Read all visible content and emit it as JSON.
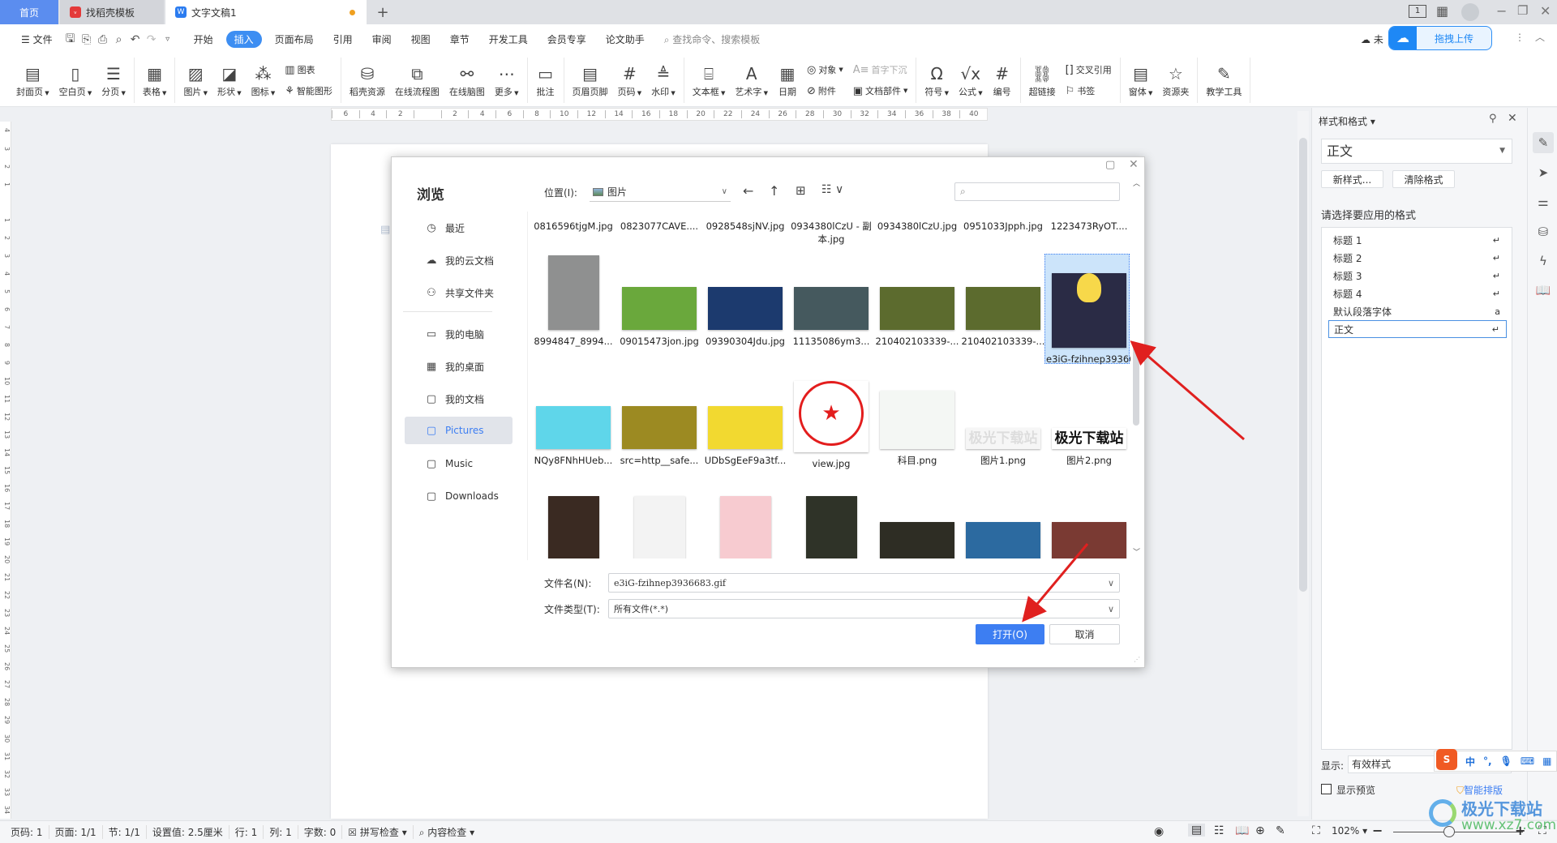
{
  "tabs": [
    {
      "label": "首页",
      "active": false
    },
    {
      "label": "找稻壳模板",
      "active": false
    },
    {
      "label": "文字文稿1",
      "active": true
    }
  ],
  "new_tab": "+",
  "menu": {
    "file": "文件",
    "items": [
      "开始",
      "插入",
      "页面布局",
      "引用",
      "审阅",
      "视图",
      "章节",
      "开发工具",
      "会员专享",
      "论文助手"
    ],
    "active": "插入",
    "search_placeholder": "查找命令、搜索模板",
    "cloud_status": "未",
    "upload_popup": "拖拽上传"
  },
  "ribbon": [
    [
      {
        "label": "封面页",
        "icon": "cover-page-icon",
        "g": "▤",
        "dd": true
      },
      {
        "label": "空白页",
        "icon": "blank-page-icon",
        "g": "▯",
        "dd": true
      },
      {
        "label": "分页",
        "icon": "page-break-icon",
        "g": "☰",
        "dd": true
      }
    ],
    [
      {
        "label": "表格",
        "icon": "table-icon",
        "g": "▦",
        "dd": true
      }
    ],
    [
      {
        "label": "图片",
        "icon": "picture-icon",
        "g": "▨",
        "dd": true
      },
      {
        "label": "形状",
        "icon": "shape-icon",
        "g": "◪",
        "dd": true
      },
      {
        "label": "图标",
        "icon": "icons-icon",
        "g": "⁂",
        "dd": true
      },
      {
        "stack": [
          {
            "label": "图表",
            "icon": "chart-icon",
            "g": "▥"
          },
          {
            "label": "智能图形",
            "icon": "smart-art-icon",
            "g": "⚘"
          }
        ]
      }
    ],
    [
      {
        "label": "稻壳资源",
        "icon": "docer-resource-icon",
        "g": "⛁"
      },
      {
        "label": "在线流程图",
        "icon": "flowchart-icon",
        "g": "⧉"
      },
      {
        "label": "在线脑图",
        "icon": "mindmap-icon",
        "g": "⚯"
      },
      {
        "label": "更多",
        "icon": "more-icon",
        "g": "⋯",
        "dd": true
      }
    ],
    [
      {
        "label": "批注",
        "icon": "comment-icon",
        "g": "▭"
      }
    ],
    [
      {
        "label": "页眉页脚",
        "icon": "header-footer-icon",
        "g": "▤"
      },
      {
        "label": "页码",
        "icon": "page-number-icon",
        "g": "#",
        "dd": true
      },
      {
        "label": "水印",
        "icon": "watermark-icon",
        "g": "≜",
        "dd": true
      }
    ],
    [
      {
        "label": "文本框",
        "icon": "textbox-icon",
        "g": "⌸",
        "dd": true
      },
      {
        "label": "艺术字",
        "icon": "wordart-icon",
        "g": "A",
        "dd": true
      },
      {
        "label": "日期",
        "icon": "date-icon",
        "g": "▦"
      },
      {
        "stack": [
          {
            "label": "对象",
            "icon": "object-icon",
            "g": "◎",
            "dd": true
          },
          {
            "label": "附件",
            "icon": "attachment-icon",
            "g": "⊘"
          }
        ]
      },
      {
        "stack": [
          {
            "label": "首字下沉",
            "icon": "drop-cap-icon",
            "g": "A≡",
            "disabled": true
          },
          {
            "label": "文档部件",
            "icon": "doc-parts-icon",
            "g": "▣",
            "dd": true
          }
        ]
      }
    ],
    [
      {
        "label": "符号",
        "icon": "symbol-icon",
        "g": "Ω",
        "dd": true
      },
      {
        "label": "公式",
        "icon": "formula-icon",
        "g": "√x",
        "dd": true
      },
      {
        "label": "编号",
        "icon": "numbering-icon",
        "g": "#"
      }
    ],
    [
      {
        "label": "超链接",
        "icon": "hyperlink-icon",
        "g": "⛓"
      },
      {
        "stack": [
          {
            "label": "交叉引用",
            "icon": "cross-ref-icon",
            "g": "[]"
          },
          {
            "label": "书签",
            "icon": "bookmark-icon",
            "g": "⚐"
          }
        ]
      }
    ],
    [
      {
        "label": "窗体",
        "icon": "form-icon",
        "g": "▤",
        "dd": true
      },
      {
        "label": "资源夹",
        "icon": "resource-folder-icon",
        "g": "☆"
      }
    ],
    [
      {
        "label": "教学工具",
        "icon": "teaching-tools-icon",
        "g": "✎"
      }
    ]
  ],
  "hruler": [
    "6",
    "4",
    "2",
    "",
    "2",
    "4",
    "6",
    "8",
    "10",
    "12",
    "14",
    "16",
    "18",
    "20",
    "22",
    "24",
    "26",
    "28",
    "30",
    "32",
    "34",
    "36",
    "38",
    "40"
  ],
  "vruler": [
    "4",
    "3",
    "2",
    "1",
    "",
    "1",
    "2",
    "3",
    "4",
    "5",
    "6",
    "7",
    "8",
    "9",
    "10",
    "11",
    "12",
    "13",
    "14",
    "15",
    "16",
    "17",
    "18",
    "19",
    "20",
    "21",
    "22",
    "23",
    "24",
    "25",
    "26",
    "27",
    "28",
    "29",
    "30",
    "31",
    "32",
    "33",
    "34"
  ],
  "dialog": {
    "title": "浏览",
    "location_label": "位置(I):",
    "location_value": "图片",
    "search_placeholder": "",
    "nav": [
      {
        "label": "最近",
        "icon": "clock-icon",
        "g": "◷"
      },
      {
        "label": "我的云文档",
        "icon": "cloud-icon",
        "g": "☁"
      },
      {
        "label": "共享文件夹",
        "icon": "share-icon",
        "g": "⚇"
      },
      {
        "label": "我的电脑",
        "icon": "computer-icon",
        "g": "▭"
      },
      {
        "label": "我的桌面",
        "icon": "desktop-icon",
        "g": "▦"
      },
      {
        "label": "我的文档",
        "icon": "folder-icon",
        "g": "▢"
      },
      {
        "label": "Pictures",
        "icon": "folder-icon",
        "g": "▢",
        "selected": true
      },
      {
        "label": "Music",
        "icon": "folder-icon",
        "g": "▢"
      },
      {
        "label": "Downloads",
        "icon": "folder-icon",
        "g": "▢"
      }
    ],
    "files": [
      [
        {
          "name": "0816596tjgM.jpg"
        },
        {
          "name": "0823077CAVE...."
        },
        {
          "name": "0928548sjNV.jpg"
        },
        {
          "name": "0934380lCzU - 副本.jpg"
        },
        {
          "name": "0934380lCzU.jpg"
        },
        {
          "name": "0951033Jpph.jpg"
        },
        {
          "name": "1223473RyOT...."
        }
      ],
      [
        {
          "name": "8994847_8994...",
          "thumb": "portrait",
          "color": "#8f9090"
        },
        {
          "name": "09015473jon.jpg",
          "thumb": "landscape",
          "color": "#6aa83c"
        },
        {
          "name": "09390304Jdu.jpg",
          "thumb": "landscape",
          "color": "#1c3a6e"
        },
        {
          "name": "11135086ym3...",
          "thumb": "landscape",
          "color": "#45595e"
        },
        {
          "name": "210402103339-...",
          "thumb": "landscape",
          "color": "#5c6b2e"
        },
        {
          "name": "210402103339-...",
          "thumb": "landscape",
          "color": "#5c6b2e"
        },
        {
          "name": "e3iG-fzihnep3936683.gif",
          "thumb": "square",
          "color": "#2a2b45",
          "selected": true
        }
      ],
      [
        {
          "name": "NQy8FNhHUeb...",
          "thumb": "landscape",
          "color": "#5fd6ea"
        },
        {
          "name": "src=http__safe...",
          "thumb": "landscape",
          "color": "#9c8a22"
        },
        {
          "name": "UDbSgEeF9a3tf...",
          "thumb": "landscape",
          "color": "#f2d930"
        },
        {
          "name": "view.jpg",
          "thumb": "stamp",
          "color": "#ffffff"
        },
        {
          "name": "科目.png",
          "thumb": "mind",
          "color": "#f4f7f4"
        },
        {
          "name": "图片1.png",
          "thumb": "banner",
          "color": "#f6f6f6",
          "text": "极光下载站"
        },
        {
          "name": "图片2.png",
          "thumb": "banner",
          "color": "#ffffff",
          "text": "极光下载站"
        }
      ],
      [
        {
          "name": "",
          "thumb": "portrait",
          "color": "#3a2a22"
        },
        {
          "name": "",
          "thumb": "portrait",
          "color": "#f3f3f3"
        },
        {
          "name": "",
          "thumb": "portrait",
          "color": "#f7cbd0"
        },
        {
          "name": "",
          "thumb": "portrait",
          "color": "#2f3328"
        },
        {
          "name": "",
          "thumb": "landscape",
          "color": "#2e2d24"
        },
        {
          "name": "",
          "thumb": "landscape",
          "color": "#2c6aa0"
        },
        {
          "name": "",
          "thumb": "landscape",
          "color": "#7a3a33"
        }
      ]
    ],
    "filename_label": "文件名(N):",
    "filename_value": "e3iG-fzihnep3936683.gif",
    "filetype_label": "文件类型(T):",
    "filetype_value": "所有文件(*.*)",
    "open_label": "打开(O)",
    "cancel_label": "取消"
  },
  "styles_panel": {
    "title": "样式和格式",
    "current": "正文",
    "new_style": "新样式...",
    "clear_format": "清除格式",
    "prompt": "请选择要应用的格式",
    "items": [
      {
        "label": "标题 1",
        "mark": "↵"
      },
      {
        "label": "标题 2",
        "mark": "↵"
      },
      {
        "label": "标题 3",
        "mark": "↵"
      },
      {
        "label": "标题 4",
        "mark": "↵"
      },
      {
        "label": "默认段落字体",
        "mark": "a"
      },
      {
        "label": "正文",
        "mark": "↵",
        "selected": true
      }
    ],
    "show_label": "显示:",
    "show_value": "有效样式",
    "preview_label": "显示预览",
    "preview_checked": false,
    "smart_layout": "智能排版"
  },
  "ime": {
    "mode": "中",
    "punct": "°,"
  },
  "status": {
    "items": [
      "页码: 1",
      "页面: 1/1",
      "节: 1/1",
      "设置值: 2.5厘米",
      "行: 1",
      "列: 1",
      "字数: 0"
    ],
    "spell": "拼写检查",
    "content": "内容检查",
    "zoom": "102%"
  },
  "watermark": {
    "title": "极光下载站",
    "url": "www.xz7.com"
  },
  "colors": {
    "accent": "#3d8ef2",
    "primary_button": "#3d7ef2",
    "arrow": "#e0201f",
    "home_tab": "#5b8def"
  }
}
